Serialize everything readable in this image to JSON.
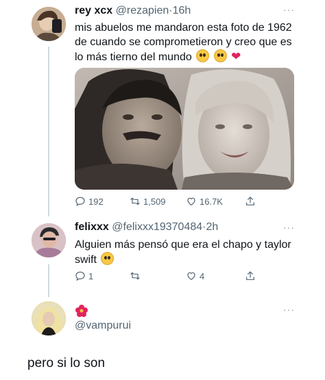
{
  "tweets": [
    {
      "name": "rey xcx",
      "handle": "@rezapien",
      "separator": "·",
      "time": "16h",
      "more": "···",
      "text": "mis abuelos me mandaron esta foto de 1962 de cuando se comprometieron y creo que es lo más tierno del mundo",
      "emojis": [
        "pleading-face",
        "pleading-face",
        "red-heart"
      ],
      "has_photo": true,
      "actions": {
        "replies": "192",
        "retweets": "1,509",
        "likes": "16.7K"
      }
    },
    {
      "name": "felixxx",
      "handle": "@felixxx19370484",
      "separator": "·",
      "time": "2h",
      "more": "···",
      "text": "Alguien más pensó que era el chapo y taylor swift",
      "emojis": [
        "astonished-face"
      ],
      "actions": {
        "replies": "1",
        "retweets": "",
        "likes": "4"
      }
    },
    {
      "handle": "@vampurui",
      "more": "···",
      "emojis": [
        "flower"
      ]
    }
  ],
  "caption": "pero si lo son",
  "icons": {
    "reply": "reply-icon",
    "retweet": "retweet-icon",
    "like": "heart-icon",
    "share": "share-icon",
    "more": "more-icon"
  },
  "colors": {
    "text": "#0f1419",
    "secondary": "#536471",
    "thread_line": "#cfd9de",
    "heart": "#e0245e"
  }
}
